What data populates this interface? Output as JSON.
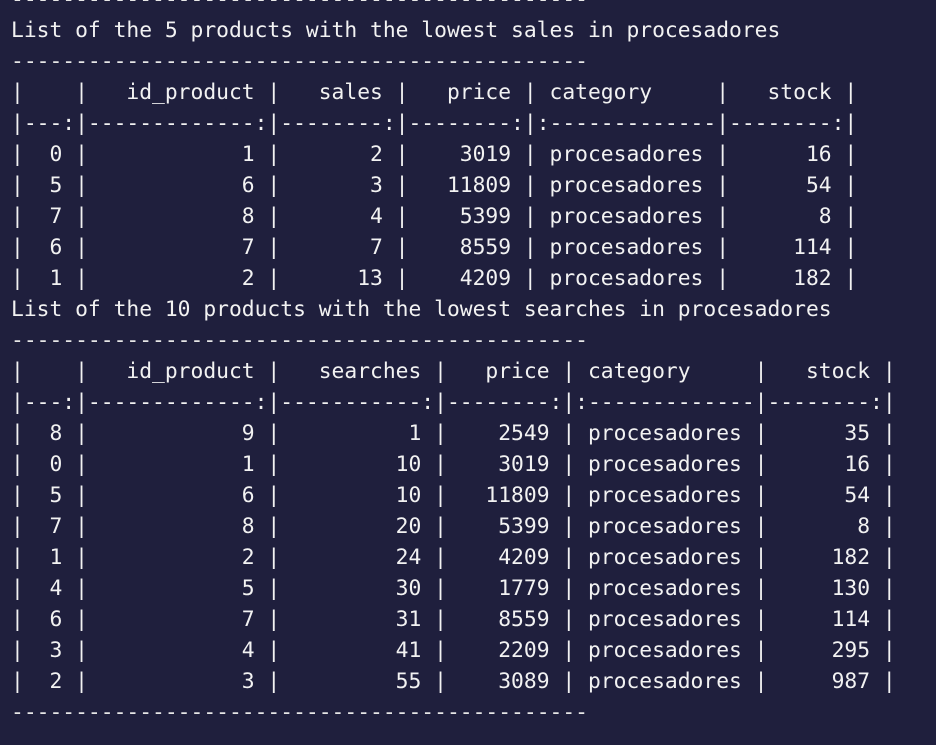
{
  "terminal": {
    "lines": [
      "---------------------------------------------",
      "List of the 5 products with the lowest sales in procesadores",
      "---------------------------------------------",
      "|    |   id_product |   sales |   price | category     |   stock |",
      "|---:|-------------:|--------:|--------:|:-------------|--------:|",
      "|  0 |            1 |       2 |    3019 | procesadores |      16 |",
      "|  5 |            6 |       3 |   11809 | procesadores |      54 |",
      "|  7 |            8 |       4 |    5399 | procesadores |       8 |",
      "|  6 |            7 |       7 |    8559 | procesadores |     114 |",
      "|  1 |            2 |      13 |    4209 | procesadores |     182 |",
      "List of the 10 products with the lowest searches in procesadores",
      "---------------------------------------------",
      "|    |   id_product |   searches |   price | category     |   stock |",
      "|---:|-------------:|-----------:|--------:|:-------------|--------:|",
      "|  8 |            9 |          1 |    2549 | procesadores |      35 |",
      "|  0 |            1 |         10 |    3019 | procesadores |      16 |",
      "|  5 |            6 |         10 |   11809 | procesadores |      54 |",
      "|  7 |            8 |         20 |    5399 | procesadores |       8 |",
      "|  1 |            2 |         24 |    4209 | procesadores |     182 |",
      "|  4 |            5 |         30 |    1779 | procesadores |     130 |",
      "|  6 |            7 |         31 |    8559 | procesadores |     114 |",
      "|  3 |            4 |         41 |    2209 | procesadores |     295 |",
      "|  2 |            3 |         55 |    3089 | procesadores |     987 |",
      "---------------------------------------------"
    ]
  }
}
